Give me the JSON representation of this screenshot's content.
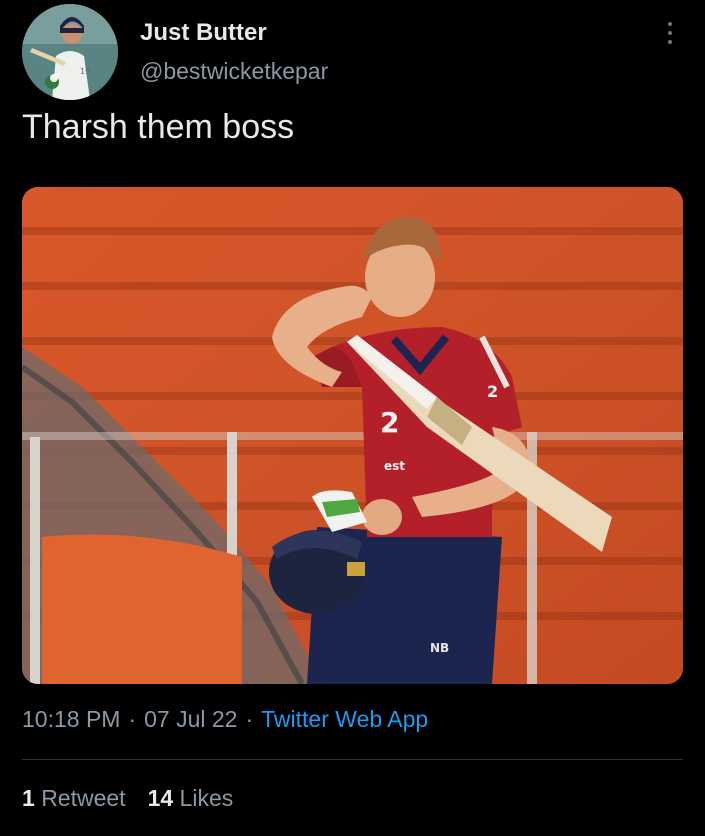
{
  "tweet": {
    "author": {
      "display_name": "Just Butter",
      "handle": "@bestwicketkepar",
      "avatar": "avatar-image"
    },
    "more_icon": "more-vertical-icon",
    "text": "Tharsh them boss",
    "media": {
      "type": "photo"
    },
    "meta": {
      "time": "10:18 PM",
      "separator": "·",
      "date": "07 Jul 22",
      "source": "Twitter Web App"
    },
    "stats": {
      "retweets_count": "1",
      "retweets_label": "Retweet",
      "likes_count": "14",
      "likes_label": "Likes"
    }
  },
  "colors": {
    "background": "#000000",
    "text_primary": "#e7e9ea",
    "text_secondary": "#8b98a5",
    "link": "#1d9bf0",
    "divider": "#2f3336"
  }
}
